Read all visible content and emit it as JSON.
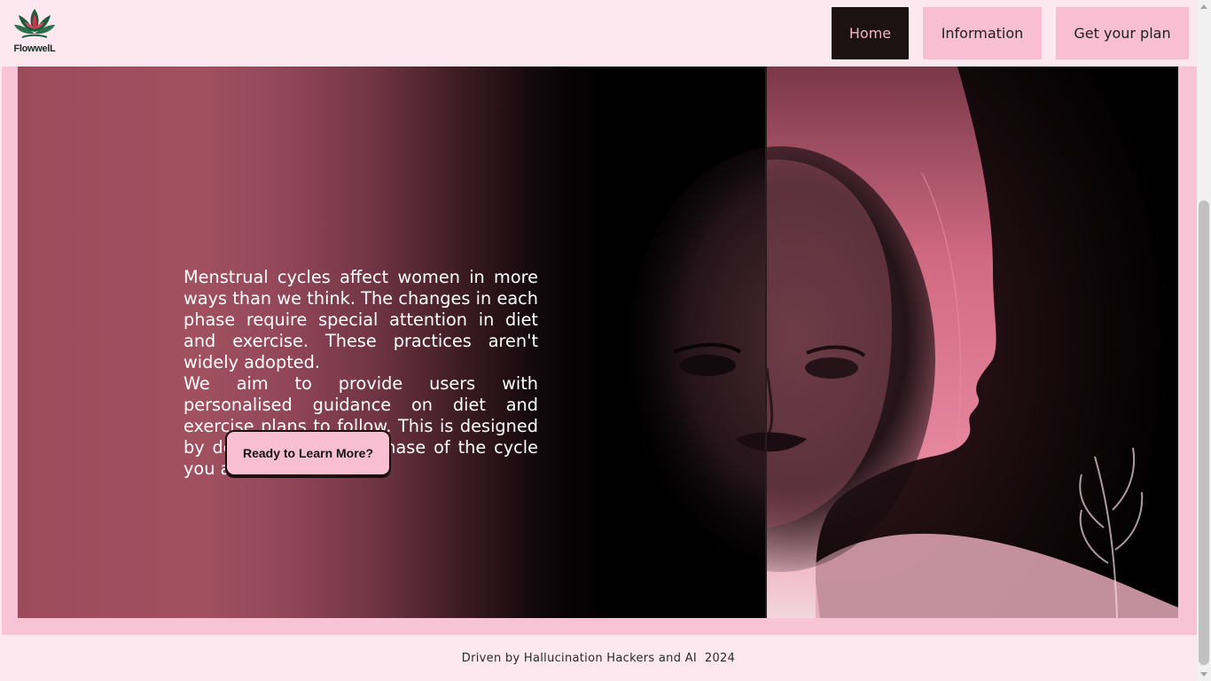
{
  "brand": {
    "name": "FlowwelL",
    "logo_icon": "lotus-logo-icon"
  },
  "nav": {
    "items": [
      {
        "label": "Home",
        "active": true
      },
      {
        "label": "Information",
        "active": false
      },
      {
        "label": "Get your plan",
        "active": false
      }
    ]
  },
  "hero": {
    "paragraph_1": "Menstrual cycles affect women in more ways than we think. The changes in each phase require special attention in diet and exercise. These practices aren't widely adopted.",
    "paragraph_2": "We aim to provide users with personalised guidance on diet and exercise plans to follow. This is designed by determining what phase of the cycle you are currently in.",
    "cta_label": "Ready to Learn More?",
    "illustration": "woman-profile-silhouette-image"
  },
  "footer": {
    "text": "Driven by Hallucination Hackers and AI  2024"
  },
  "colors": {
    "page_background": "#fde8f0",
    "accent_pink": "#f8bfd2",
    "active_nav": "#1c1214",
    "hero_rose": "#9c4b5c"
  }
}
